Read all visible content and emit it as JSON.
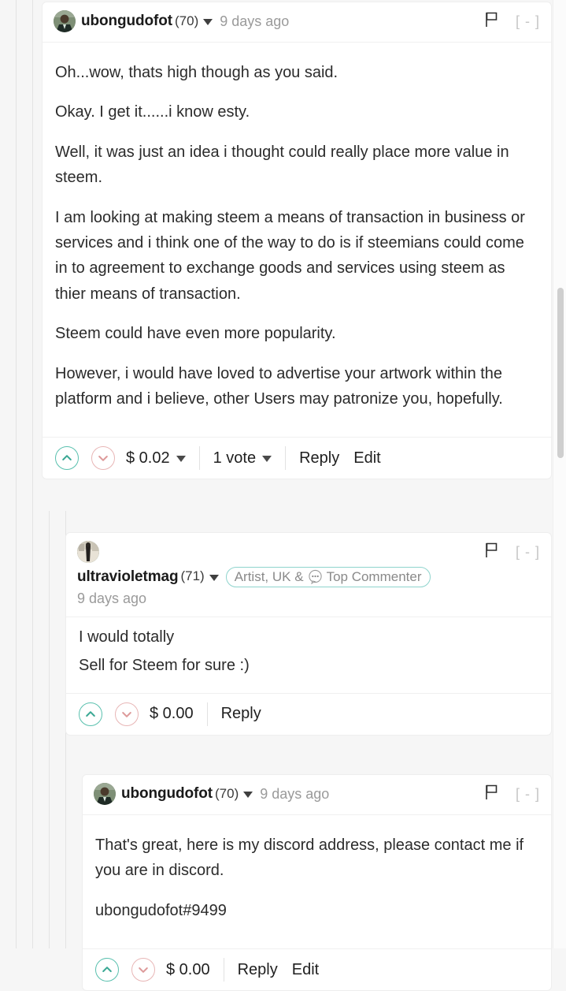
{
  "page": {
    "background": "#f6f6f6",
    "card_background": "#ffffff",
    "accent_upvote": "#59c0ae",
    "accent_downvote": "#e8b6b6",
    "badge_border": "#8fd4cd",
    "muted_text": "#9a9a9a"
  },
  "comments": [
    {
      "author": "ubongudofot",
      "reputation": "(70)",
      "timestamp": "9 days ago",
      "avatar_icon": "user-avatar-photo",
      "flag_icon": "flag-icon",
      "collapse_label": "[ - ]",
      "paragraphs": [
        "Oh...wow, thats high though as you said.",
        "Okay. I get it......i know esty.",
        "Well, it was just an idea i thought could really place more value in steem.",
        "I am looking at making steem a means of transaction in business or services and i think one of the way to do is if steemians could come in to agreement to exchange goods and services using steem as thier means of transaction.",
        "Steem could have even more popularity.",
        "However, i would have loved to advertise your artwork within the platform and i believe, other Users may patronize you, hopefully."
      ],
      "payout": "$ 0.02",
      "votes": "1 vote",
      "reply_label": "Reply",
      "edit_label": "Edit",
      "upvote_icon": "chevron-up-icon",
      "downvote_icon": "chevron-down-icon"
    },
    {
      "author": "ultravioletmag",
      "reputation": "(71)",
      "timestamp": "9 days ago",
      "avatar_icon": "user-avatar-photo",
      "flag_icon": "flag-icon",
      "collapse_label": "[ - ]",
      "badge": {
        "text_before": "Artist, UK &",
        "icon": "chat-bubble-dots-icon",
        "text_after": "Top Commenter"
      },
      "paragraphs": [
        "I would totally",
        "Sell for Steem for sure :)"
      ],
      "payout": "$ 0.00",
      "reply_label": "Reply",
      "upvote_icon": "chevron-up-icon",
      "downvote_icon": "chevron-down-icon"
    },
    {
      "author": "ubongudofot",
      "reputation": "(70)",
      "timestamp": "9 days ago",
      "avatar_icon": "user-avatar-photo",
      "flag_icon": "flag-icon",
      "collapse_label": "[ - ]",
      "paragraphs": [
        "That's great, here is my discord address, please contact me if you are in discord.",
        "ubongudofot#9499"
      ],
      "payout": "$ 0.00",
      "reply_label": "Reply",
      "edit_label": "Edit",
      "upvote_icon": "chevron-up-icon",
      "downvote_icon": "chevron-down-icon"
    }
  ]
}
